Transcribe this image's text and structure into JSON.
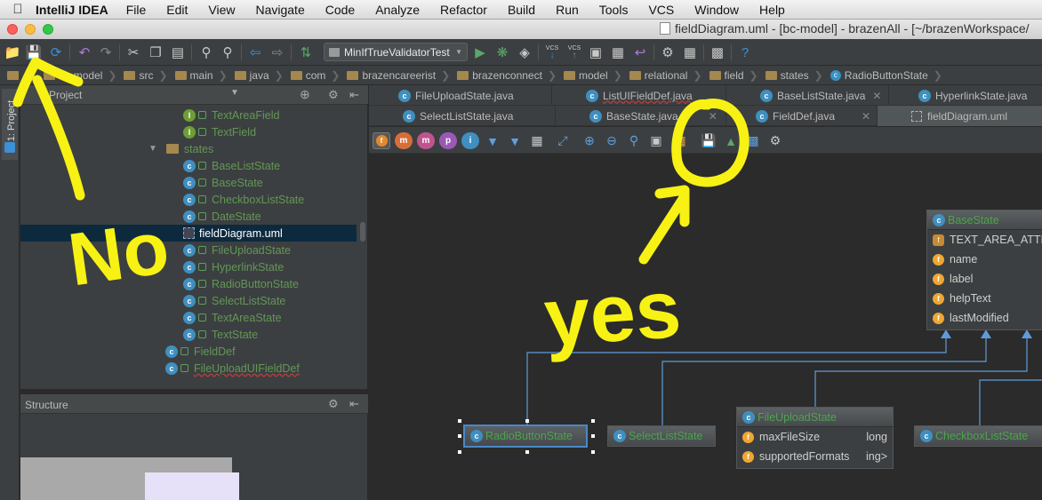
{
  "menubar": {
    "app_name": "IntelliJ IDEA",
    "items": [
      "File",
      "Edit",
      "View",
      "Navigate",
      "Code",
      "Analyze",
      "Refactor",
      "Build",
      "Run",
      "Tools",
      "VCS",
      "Window",
      "Help"
    ]
  },
  "window": {
    "title": "fieldDiagram.uml - [bc-model] - brazenAll - [~/brazenWorkspace/"
  },
  "toolbar": {
    "run_config": "MinIfTrueValidatorTest",
    "vcs_label_1": "VCS",
    "vcs_label_2": "VCS"
  },
  "breadcrumbs": [
    "bc-model",
    "src",
    "main",
    "java",
    "com",
    "brazencareerist",
    "brazenconnect",
    "model",
    "relational",
    "field",
    "states",
    "RadioButtonState"
  ],
  "side_tab": {
    "label": "1: Project"
  },
  "project_panel": {
    "title": "Project",
    "tree": [
      {
        "label": "TextAreaField",
        "icon": "I"
      },
      {
        "label": "TextField",
        "icon": "I"
      },
      {
        "label": "states",
        "icon": "folder"
      },
      {
        "label": "BaseListState",
        "icon": "C"
      },
      {
        "label": "BaseState",
        "icon": "C"
      },
      {
        "label": "CheckboxListState",
        "icon": "C"
      },
      {
        "label": "DateState",
        "icon": "C"
      },
      {
        "label": "fieldDiagram.uml",
        "icon": "uml"
      },
      {
        "label": "FileUploadState",
        "icon": "C"
      },
      {
        "label": "HyperlinkState",
        "icon": "C"
      },
      {
        "label": "RadioButtonState",
        "icon": "C"
      },
      {
        "label": "SelectListState",
        "icon": "C"
      },
      {
        "label": "TextAreaState",
        "icon": "C"
      },
      {
        "label": "TextState",
        "icon": "C"
      },
      {
        "label": "FieldDef",
        "icon": "C"
      },
      {
        "label": "FileUploadUIFieldDef",
        "icon": "C"
      }
    ]
  },
  "structure_panel": {
    "title": "Structure"
  },
  "editor_tabs": {
    "row1": [
      "FileUploadState.java",
      "ListUIFieldDef.java",
      "BaseListState.java",
      "HyperlinkState.java"
    ],
    "row2": [
      "SelectListState.java",
      "BaseState.java",
      "FieldDef.java",
      "fieldDiagram.uml"
    ]
  },
  "diagram_toolbar": {
    "toggles": [
      "f",
      "m",
      "m",
      "p",
      "i"
    ]
  },
  "diagram": {
    "base_state": {
      "title": "BaseState",
      "fields": [
        "TEXT_AREA_ATTR",
        "name",
        "label",
        "helpText",
        "lastModified"
      ]
    },
    "radio_button_state": {
      "title": "RadioButtonState"
    },
    "select_list_state": {
      "title": "SelectListState"
    },
    "file_upload_state": {
      "title": "FileUploadState",
      "fields": [
        {
          "name": "maxFileSize",
          "type": "long"
        },
        {
          "name": "supportedFormats",
          "type": "ing>"
        }
      ]
    },
    "checkbox_list_state": {
      "title": "CheckboxListState"
    }
  },
  "annotations": {
    "no": "No",
    "yes": "yes"
  },
  "colors": {
    "annotation": "#f7f214",
    "class_green": "#629755",
    "link": "#5f9bd8"
  }
}
